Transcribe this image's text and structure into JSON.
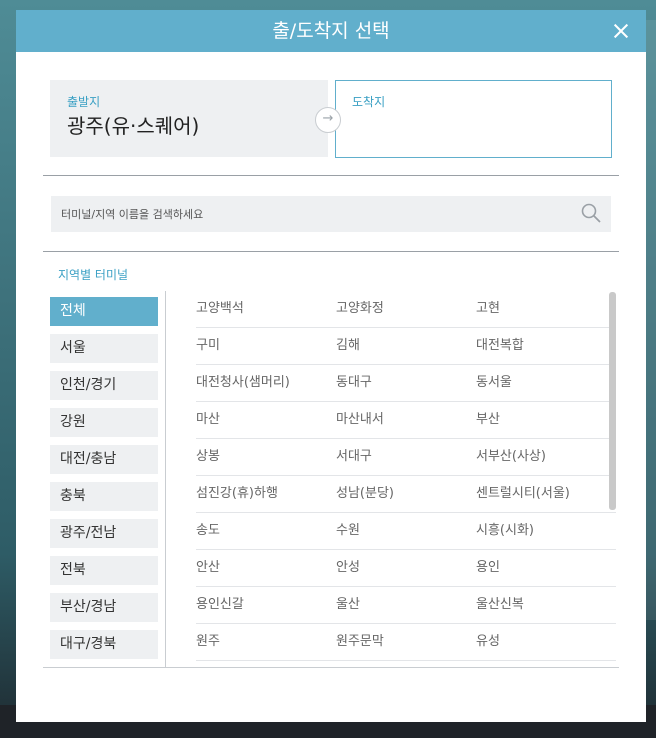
{
  "modal": {
    "title": "출/도착지 선택"
  },
  "departure": {
    "label": "출발지",
    "value": "광주(유·스퀘어)"
  },
  "arrival": {
    "label": "도착지",
    "value": ""
  },
  "search": {
    "placeholder": "터미널/지역 이름을 검색하세요"
  },
  "regions": {
    "title": "지역별 터미널",
    "items": [
      {
        "label": "전체",
        "active": true
      },
      {
        "label": "서울"
      },
      {
        "label": "인천/경기"
      },
      {
        "label": "강원"
      },
      {
        "label": "대전/충남"
      },
      {
        "label": "충북"
      },
      {
        "label": "광주/전남"
      },
      {
        "label": "전북"
      },
      {
        "label": "부산/경남"
      },
      {
        "label": "대구/경북"
      }
    ]
  },
  "terminals": {
    "rows": [
      [
        "고양백석",
        "고양화정",
        "고현"
      ],
      [
        "구미",
        "김해",
        "대전복합"
      ],
      [
        "대전청사(샘머리)",
        "동대구",
        "동서울"
      ],
      [
        "마산",
        "마산내서",
        "부산"
      ],
      [
        "상봉",
        "서대구",
        "서부산(사상)"
      ],
      [
        "섬진강(휴)하행",
        "성남(분당)",
        "센트럴시티(서울)"
      ],
      [
        "송도",
        "수원",
        "시흥(시화)"
      ],
      [
        "안산",
        "안성",
        "용인"
      ],
      [
        "용인신갈",
        "울산",
        "울산신복"
      ],
      [
        "원주",
        "원주문막",
        "유성"
      ]
    ]
  }
}
